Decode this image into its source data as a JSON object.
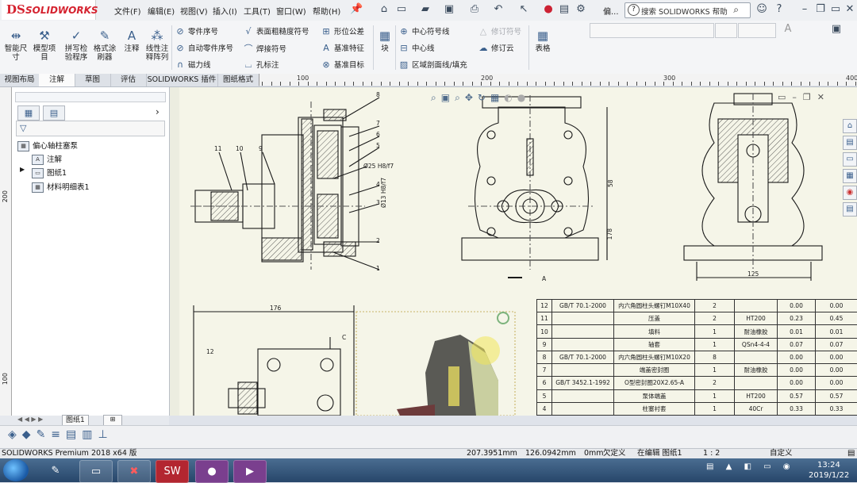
{
  "app": {
    "brand": "SOLIDWORKS",
    "brand_prefix": "DS"
  },
  "menu": [
    "文件(F)",
    "编辑(E)",
    "视图(V)",
    "插入(I)",
    "工具(T)",
    "窗口(W)",
    "帮助(H)"
  ],
  "title_overflow": "偏...",
  "help_search": {
    "placeholder": "搜索 SOLIDWORKS 帮助"
  },
  "ribbon": {
    "big_buttons": [
      {
        "label": "智能尺\n寸",
        "icon": "smart-dimension"
      },
      {
        "label": "模型项\n目",
        "icon": "model-items"
      },
      {
        "label": "拼写检\n验程序",
        "icon": "spell-check"
      },
      {
        "label": "格式涂\n刷器",
        "icon": "format-painter"
      },
      {
        "label": "注释",
        "icon": "note"
      },
      {
        "label": "线性注\n释阵列",
        "icon": "linear-note-pattern"
      }
    ],
    "col1": [
      "零件序号",
      "自动零件序号",
      "磁力线"
    ],
    "col2": [
      "表面粗糙度符号",
      "焊接符号",
      "孔标注"
    ],
    "col3": [
      "形位公差",
      "基准特征",
      "基准目标"
    ],
    "block_label": "块",
    "col4": [
      "中心符号线",
      "中心线",
      "区域剖面线/填充"
    ],
    "col5": [
      "修订符号",
      "修订云"
    ],
    "table_label": "表格"
  },
  "tabs": [
    "视图布局",
    "注解",
    "草图",
    "评估",
    "SOLIDWORKS 插件",
    "图纸格式"
  ],
  "active_tab": "注解",
  "ruler_labels": [
    "100",
    "200",
    "300",
    "400"
  ],
  "vruler_labels": [
    "200",
    "100"
  ],
  "tree": {
    "root": "偏心轴柱塞泵",
    "items": [
      "注解",
      "图纸1",
      "材料明细表1"
    ]
  },
  "sheet_tab": "图纸1",
  "bom": [
    [
      "12",
      "GB/T 70.1-2000",
      "内六角圆柱头螺钉M10X40",
      "2",
      "",
      "0.00",
      "0.00"
    ],
    [
      "11",
      "",
      "压盖",
      "2",
      "HT200",
      "0.23",
      "0.45"
    ],
    [
      "10",
      "",
      "填料",
      "1",
      "耐油橡胶",
      "0.01",
      "0.01"
    ],
    [
      "9",
      "",
      "轴套",
      "1",
      "QSn4-4-4",
      "0.07",
      "0.07"
    ],
    [
      "8",
      "GB/T 70.1-2000",
      "内六角圆柱头螺钉M10X20",
      "8",
      "",
      "0.00",
      "0.00"
    ],
    [
      "7",
      "",
      "端盖密封圈",
      "1",
      "耐油橡胶",
      "0.00",
      "0.00"
    ],
    [
      "6",
      "GB/T 3452.1-1992",
      "O型密封圈20X2.65-A",
      "2",
      "",
      "0.00",
      "0.00"
    ],
    [
      "5",
      "",
      "泵体端盖",
      "1",
      "HT200",
      "0.57",
      "0.57"
    ],
    [
      "4",
      "",
      "柱塞衬套",
      "1",
      "40Cr",
      "0.33",
      "0.33"
    ]
  ],
  "dims": [
    "176",
    "125",
    "178",
    "58",
    "Ø25 H8/f7",
    "Ø13 H8/f7",
    "A",
    "C"
  ],
  "balloons": [
    "8",
    "7",
    "6",
    "5",
    "4",
    "3",
    "2",
    "1",
    "11",
    "10",
    "9",
    "12"
  ],
  "status": {
    "product": "SOLIDWORKS Premium 2018 x64 版",
    "x": "207.3951mm",
    "y": "126.0942mm",
    "z": "0mm",
    "defined": "欠定义",
    "editing": "在编辑 图纸1",
    "scale": "1 : 2",
    "units": "自定义"
  },
  "taskbar": {
    "time": "13:24",
    "date": "2019/1/22"
  },
  "colors": {
    "brand_red": "#d5222f",
    "canvas": "#f5f5e8",
    "taskbar": "#2b4a6f"
  }
}
